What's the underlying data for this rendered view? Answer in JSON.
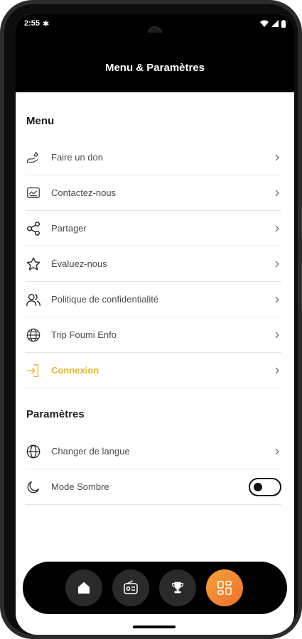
{
  "status_bar": {
    "time": "2:55"
  },
  "header": {
    "title": "Menu & Paramètres"
  },
  "menu": {
    "title": "Menu",
    "items": [
      {
        "label": "Faire un don",
        "icon": "donate-hand-icon"
      },
      {
        "label": "Contactez-nous",
        "icon": "contact-message-icon"
      },
      {
        "label": "Partager",
        "icon": "share-icon"
      },
      {
        "label": "Évaluez-nous",
        "icon": "star-icon"
      },
      {
        "label": "Politique de confidentialité",
        "icon": "users-icon"
      },
      {
        "label": "Trip Foumi Enfo",
        "icon": "globe-icon"
      },
      {
        "label": "Connexion",
        "icon": "login-icon"
      }
    ]
  },
  "settings": {
    "title": "Paramètres",
    "items": [
      {
        "label": "Changer de langue",
        "icon": "language-globe-icon"
      },
      {
        "label": "Mode Sombre",
        "icon": "moon-icon",
        "toggle": false
      }
    ]
  },
  "bottom_nav": {
    "items": [
      {
        "icon": "home-icon",
        "active": false
      },
      {
        "icon": "radio-icon",
        "active": false
      },
      {
        "icon": "trophy-icon",
        "active": false
      },
      {
        "icon": "grid-menu-icon",
        "active": true
      }
    ]
  },
  "colors": {
    "accent_gold": "#e2b43b",
    "active_gradient_start": "#f2a33a",
    "active_gradient_end": "#ef6f2e",
    "header_bg": "#000000"
  }
}
